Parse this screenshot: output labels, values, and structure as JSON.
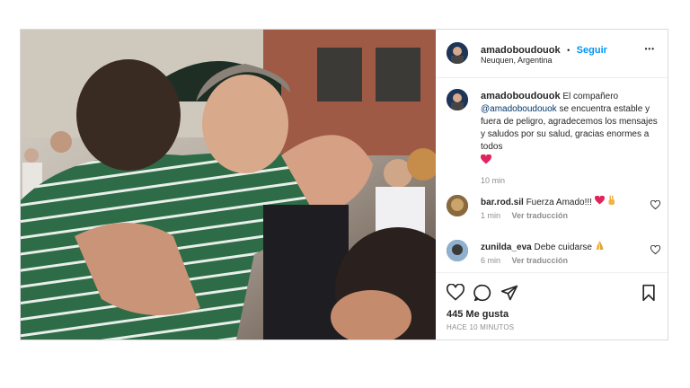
{
  "post": {
    "author": "amadoboudouok",
    "separator": "•",
    "follow_label": "Seguir",
    "location": "Neuquen, Argentina",
    "more_label": "•••",
    "caption": {
      "author": "amadoboudouok",
      "text_before": "El compañero ",
      "mention": "@amadoboudouok",
      "text_after": " se encuentra estable y fuera de peligro, agradecemos los mensajes y saludos por su salud, gracias enormes a todos",
      "emoji": "red-heart-icon",
      "time": "10 min"
    },
    "comments": [
      {
        "user": "bar.rod.sil",
        "text": "Fuerza Amado!!!",
        "emojis": [
          "red-heart-icon",
          "victory-hand-icon"
        ],
        "time": "1 min",
        "reply_label": "Ver traducción"
      },
      {
        "user": "zunilda_eva",
        "text": "Debe cuidarse",
        "emojis": [
          "folded-hands-icon"
        ],
        "time": "6 min",
        "reply_label": "Ver traducción"
      }
    ],
    "likes": "445 Me gusta",
    "timestamp": "HACE 10 MINUTOS"
  }
}
